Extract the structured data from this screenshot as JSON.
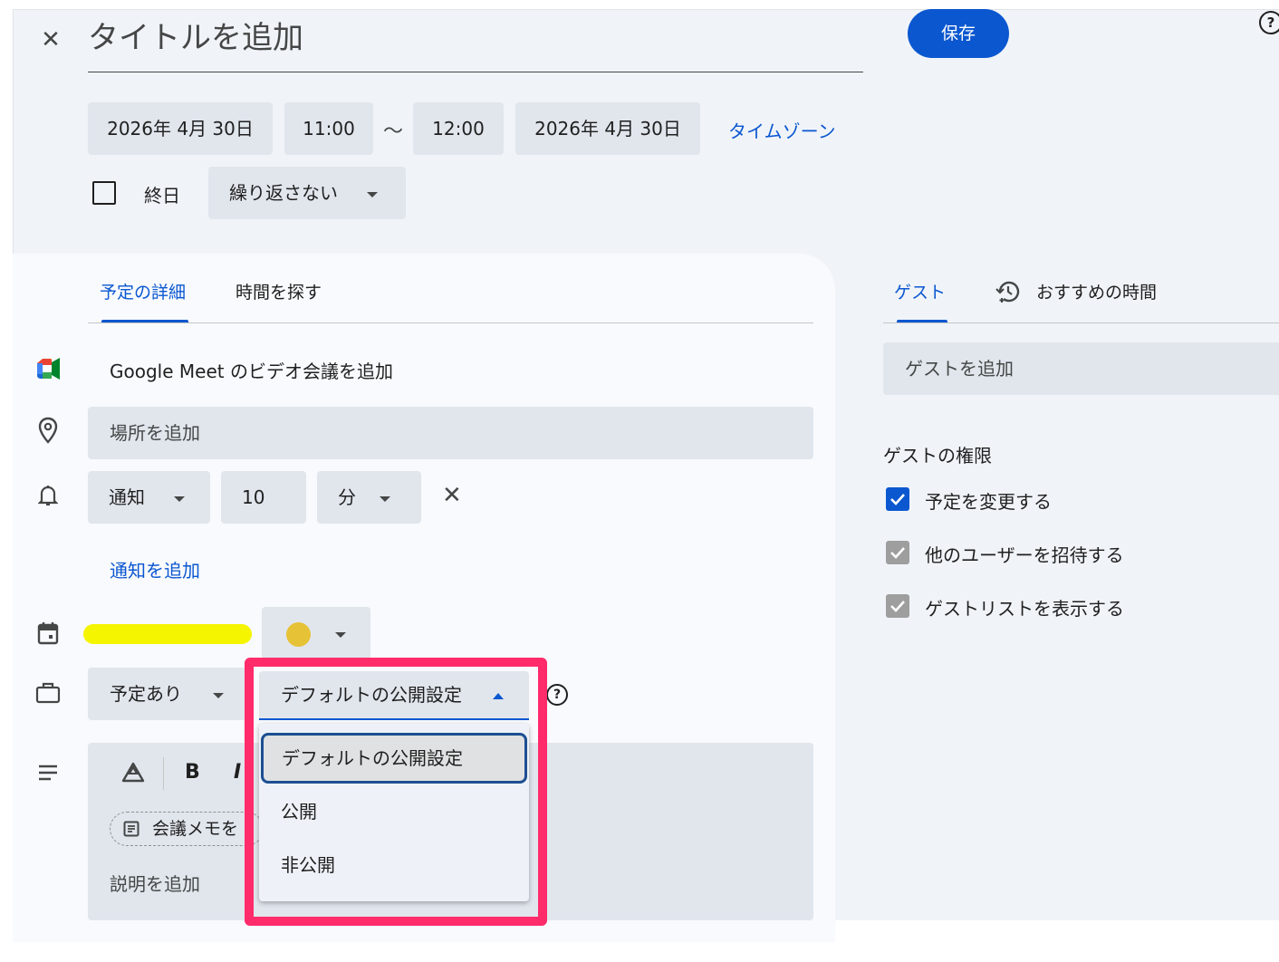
{
  "header": {
    "title_placeholder": "タイトルを追加",
    "save_label": "保存",
    "help": "?"
  },
  "datetime": {
    "start_date": "2026年 4月 30日",
    "start_time": "11:00",
    "separator": "〜",
    "end_time": "12:00",
    "end_date": "2026年 4月 30日",
    "timezone_link": "タイムゾーン"
  },
  "allday": {
    "label": "終日",
    "checked": false
  },
  "repeat": {
    "value": "繰り返さない"
  },
  "tabs": [
    {
      "label": "予定の詳細",
      "active": true
    },
    {
      "label": "時間を探す",
      "active": false
    }
  ],
  "details": {
    "meet_label": "Google Meet のビデオ会議を追加",
    "location_placeholder": "場所を追加",
    "notification": {
      "type": "通知",
      "amount": "10",
      "unit": "分"
    },
    "add_notification": "通知を追加",
    "calendar_color": "#e6c236",
    "calendar_name_highlight": "#f5f500",
    "busy": "予定あり",
    "visibility": {
      "current": "デフォルトの公開設定",
      "options": [
        "デフォルトの公開設定",
        "公開",
        "非公開"
      ]
    },
    "toolbar": {
      "bold": "B",
      "italic": "I"
    },
    "meeting_notes_chip": "会議メモを",
    "description_placeholder": "説明を追加"
  },
  "right": {
    "tabs": [
      {
        "label": "ゲスト",
        "active": true
      },
      {
        "label": "おすすめの時間",
        "active": false
      }
    ],
    "guest_placeholder": "ゲストを追加",
    "permissions_title": "ゲストの権限",
    "permissions": [
      {
        "label": "予定を変更する",
        "checked": true,
        "enabled": true
      },
      {
        "label": "他のユーザーを招待する",
        "checked": true,
        "enabled": false
      },
      {
        "label": "ゲストリストを表示する",
        "checked": true,
        "enabled": false
      }
    ]
  },
  "colors": {
    "accent": "#0b57d0",
    "highlight_frame": "#ff2b6b"
  }
}
